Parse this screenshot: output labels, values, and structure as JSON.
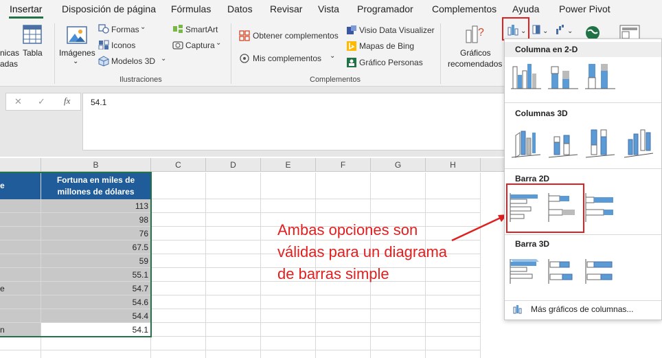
{
  "tabs": [
    "Insertar",
    "Disposición de página",
    "Fórmulas",
    "Datos",
    "Revisar",
    "Vista",
    "Programador",
    "Complementos",
    "Ayuda",
    "Power Pivot"
  ],
  "ribbon": {
    "tablas_left_1": "nicas",
    "tablas_left_2": "adas",
    "tabla": "Tabla",
    "imagenes": "Imágenes",
    "formas": "Formas",
    "iconos": "Iconos",
    "modelos3d": "Modelos 3D",
    "smartart": "SmartArt",
    "captura": "Captura",
    "ilustraciones": "Ilustraciones",
    "obtener": "Obtener complementos",
    "mis": "Mis complementos",
    "visio": "Visio Data Visualizer",
    "bing": "Mapas de Bing",
    "personas": "Gráfico Personas",
    "complementos": "Complementos",
    "graficos_1": "Gráficos",
    "graficos_2": "recomendados"
  },
  "formula": {
    "cancel": "✕",
    "enter": "✓",
    "fx": "fx",
    "value": "54.1"
  },
  "columns": [
    "B",
    "C",
    "D",
    "E",
    "F",
    "G",
    "H"
  ],
  "header": {
    "a_fragment": "e",
    "b_line1": "Fortuna en miles de",
    "b_line2": "millones de dólares"
  },
  "rows": [
    {
      "a": "",
      "b": "113"
    },
    {
      "a": "",
      "b": "98"
    },
    {
      "a": "",
      "b": "76"
    },
    {
      "a": "",
      "b": "67.5"
    },
    {
      "a": "",
      "b": "59"
    },
    {
      "a": "",
      "b": "55.1"
    },
    {
      "a": "e",
      "b": "54.7"
    },
    {
      "a": "",
      "b": "54.6"
    },
    {
      "a": "",
      "b": "54.4"
    },
    {
      "a": "n",
      "b": "54.1"
    }
  ],
  "dropdown": {
    "col2d": "Columna en 2-D",
    "col3d": "Columnas 3D",
    "bar2d": "Barra 2D",
    "bar3d": "Barra 3D",
    "more": "Más gráficos de columnas..."
  },
  "annotation": {
    "line1": "Ambas opciones son",
    "line2": "válidas para un diagrama",
    "line3": "de barras simple"
  },
  "colors": {
    "accent_green": "#217346",
    "header_blue": "#1f5c99",
    "chart_blue": "#5b9bd5",
    "annotation_red": "#e02020"
  }
}
